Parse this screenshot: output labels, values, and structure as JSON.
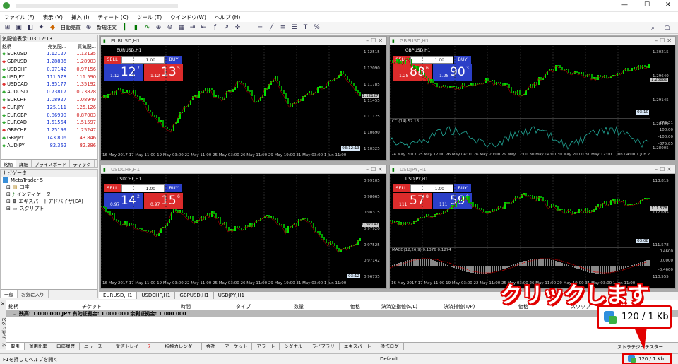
{
  "window": {
    "title_blur": "",
    "minimize": "—",
    "maximize": "☐",
    "close": "✕"
  },
  "menu": [
    "ファイル (F)",
    "表示 (V)",
    "挿入 (I)",
    "チャート (C)",
    "ツール (T)",
    "ウインドウ(W)",
    "ヘルプ (H)"
  ],
  "toolbar": {
    "auto_trade": "自動売買",
    "new_order": "新規注文"
  },
  "market_watch": {
    "header": "気配値表示: 03:12:13",
    "columns": [
      "銘柄",
      "売気配...",
      "買気配..."
    ],
    "rows": [
      {
        "sym": "EURUSD",
        "bid": "1.12127",
        "ask": "1.12135"
      },
      {
        "sym": "GBPUSD",
        "bid": "1.28886",
        "ask": "1.28903"
      },
      {
        "sym": "USDCHF",
        "bid": "0.97142",
        "ask": "0.97156"
      },
      {
        "sym": "USDJPY",
        "bid": "111.578",
        "ask": "111.590"
      },
      {
        "sym": "USDCAD",
        "bid": "1.35177",
        "ask": "1.35192"
      },
      {
        "sym": "AUDUSD",
        "bid": "0.73817",
        "ask": "0.73828"
      },
      {
        "sym": "EURCHF",
        "bid": "1.08927",
        "ask": "1.08949"
      },
      {
        "sym": "EURJPY",
        "bid": "125.111",
        "ask": "125.126"
      },
      {
        "sym": "EURGBP",
        "bid": "0.86990",
        "ask": "0.87003"
      },
      {
        "sym": "EURCAD",
        "bid": "1.51564",
        "ask": "1.51597"
      },
      {
        "sym": "GBPCHF",
        "bid": "1.25199",
        "ask": "1.25247"
      },
      {
        "sym": "GBPJPY",
        "bid": "143.806",
        "ask": "143.846"
      },
      {
        "sym": "AUDJPY",
        "bid": "82.362",
        "ask": "82.386"
      }
    ],
    "tabs": [
      "銘柄",
      "詳細",
      "プライスボード",
      "ティック"
    ]
  },
  "navigator": {
    "header": "ナビゲータ",
    "root": "MetaTrader 5",
    "items": [
      "口座",
      "インディケータ",
      "エキスパートアドバイザ(EA)",
      "スクリプト"
    ],
    "tabs": [
      "一般",
      "お気に入り"
    ]
  },
  "charts": [
    {
      "title": "EURUSD,H1",
      "sym": "EURUSD,H1",
      "sell": "SELL",
      "buy": "BUY",
      "vol": "1.00",
      "sell_pre": "1.12",
      "sell_big": "12",
      "sell_sup": "7",
      "buy_pre": "1.12",
      "buy_big": "13",
      "buy_sup": "5",
      "prices": [
        "1.12515",
        "1.12090",
        "1.11785",
        "1.11455",
        "1.11125",
        "1.10690",
        "1.10325"
      ],
      "times": "16 May 2017   17 May 11:00   19 May 03:00   22 May 11:00   25 May 03:00   26 May 11:00   29 May 19:00   31 May 03:00   1 Jun 11:00",
      "cur": "1.12127",
      "lbl": "03:12:13"
    },
    {
      "title": "GBPUSD,H1",
      "sym": "GBPUSD,H1",
      "sell": "SELL",
      "buy": "BUY",
      "vol": "1.00",
      "sell_pre": "1.28",
      "sell_big": "88",
      "sell_sup": "6",
      "buy_pre": "1.28",
      "buy_big": "90",
      "buy_sup": "3",
      "prices": [
        "1.30215",
        "1.29640",
        "1.29145",
        "1.28490",
        "1.28005"
      ],
      "ind": "CCI(14) 57.13",
      "indv": [
        "274.31",
        "100.00",
        "-100.00",
        "-375.85"
      ],
      "times": "24 May 2017   25 May 12:00   26 May 04:00   26 May 20:00   29 May 12:00   30 May 04:00   30 May 20:00   31 May 12:00   1 Jun 04:00   1 Jun 20:00",
      "cur": "1.28886",
      "lbl": "03:10"
    },
    {
      "title": "USDCHF,H1",
      "sym": "USDCHF,H1",
      "sell": "SELL",
      "buy": "BUY",
      "vol": "1.00",
      "sell_pre": "0.97",
      "sell_big": "14",
      "sell_sup": "2",
      "buy_pre": "0.97",
      "buy_big": "15",
      "buy_sup": "6",
      "prices": [
        "0.99105",
        "0.98665",
        "0.98315",
        "0.97920",
        "0.97525",
        "0.97142",
        "0.96735"
      ],
      "times": "16 May 2017   17 May 11:00   19 May 03:00   22 May 11:00   25 May 03:00   26 May 11:00   29 May 19:00   31 May 03:00   1 Jun 11:00",
      "cur": "0.97142",
      "lbl": "03:12"
    },
    {
      "title": "USDJPY,H1",
      "sym": "USDJPY,H1",
      "sell": "SELL",
      "buy": "BUY",
      "vol": "1.00",
      "sell_pre": "111",
      "sell_big": "57",
      "sell_sup": "8",
      "buy_pre": "111",
      "buy_big": "59",
      "buy_sup": "0",
      "prices": [
        "113.815",
        "112.695",
        "111.578",
        "110.555"
      ],
      "ind": "MACD(12,26,9) 0.1376 0.1274",
      "indv": [
        "0.4600",
        "0.0000",
        "-0.4600"
      ],
      "times": "16 May 2017   17 May 11:00   19 May 03:00   22 May 11:00   25 May 03:00   26 May 11:00   29 May 19:00   31 May 03:00   1 Jun 11:00",
      "cur": "111.578",
      "lbl": "03:08"
    }
  ],
  "chart_tabs": [
    "EURUSD,H1",
    "USDCHF,H1",
    "GBPUSD,H1",
    "USDJPY,H1"
  ],
  "terminal": {
    "vert_label": "ツールボックス",
    "cols": [
      "銘柄",
      "チケット",
      "時間",
      "タイプ",
      "数量",
      "価格",
      "決済逆指値(S/L)",
      "決済指値(T/P)",
      "価格",
      "スワップ"
    ],
    "balance": "残高: 1 000 000 JPY  有効証拠金: 1 000 000  余剰証拠金: 1 000 000",
    "tabs": [
      "取引",
      "運用比率",
      "口座履歴",
      "ニュース",
      "受信トレイ",
      "指標カレンダー",
      "会社",
      "マーケット",
      "アラート",
      "シグナル",
      "ライブラリ",
      "エキスパート",
      "操作ログ"
    ],
    "inbox_badge": "7",
    "right_tab": "ストラテジーテスター"
  },
  "status": {
    "help": "F1を押してヘルプを開く",
    "profile": "Default",
    "traffic": "120 / 1 Kb"
  },
  "annotation": {
    "callout": "クリックします",
    "zoom_text": "120 / 1 Kb"
  },
  "colors": {
    "bull": "#00e000",
    "bear": "#00a000",
    "sell": "#dc2b2b",
    "buy": "#2b3fc7",
    "accent": "#e20000"
  }
}
